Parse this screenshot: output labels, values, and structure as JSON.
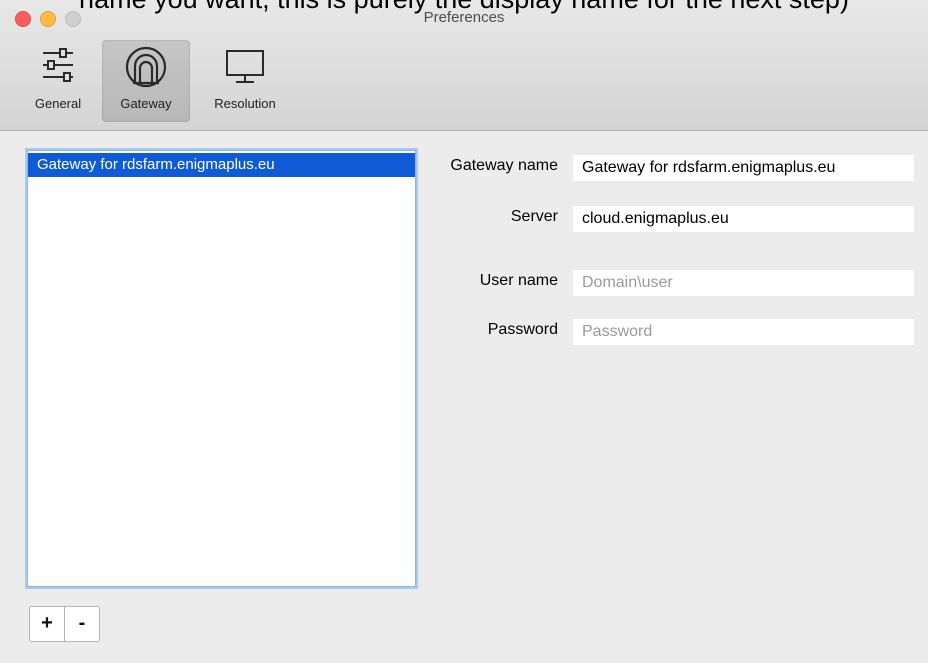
{
  "caption": "name you want, this is purely the display name for the next step)",
  "window": {
    "title": "Preferences"
  },
  "toolbar": {
    "items": [
      {
        "label": "General",
        "icon": "sliders-icon",
        "selected": false
      },
      {
        "label": "Gateway",
        "icon": "gateway-tunnel-icon",
        "selected": true
      },
      {
        "label": "Resolution",
        "icon": "monitor-icon",
        "selected": false
      }
    ]
  },
  "gateway_list": {
    "items": [
      {
        "label": "Gateway for rdsfarm.enigmaplus.eu",
        "selected": true
      }
    ],
    "add_label": "+",
    "remove_label": "-"
  },
  "form": {
    "gateway_name": {
      "label": "Gateway name",
      "value": "Gateway for rdsfarm.enigmaplus.eu"
    },
    "server": {
      "label": "Server",
      "value": "cloud.enigmaplus.eu"
    },
    "user_name": {
      "label": "User name",
      "value": "",
      "placeholder": "Domain\\user"
    },
    "password": {
      "label": "Password",
      "value": "",
      "placeholder": "Password"
    }
  },
  "colors": {
    "selection": "#0f5bd6",
    "close": "#fc605c",
    "minimize": "#fdbc40"
  }
}
